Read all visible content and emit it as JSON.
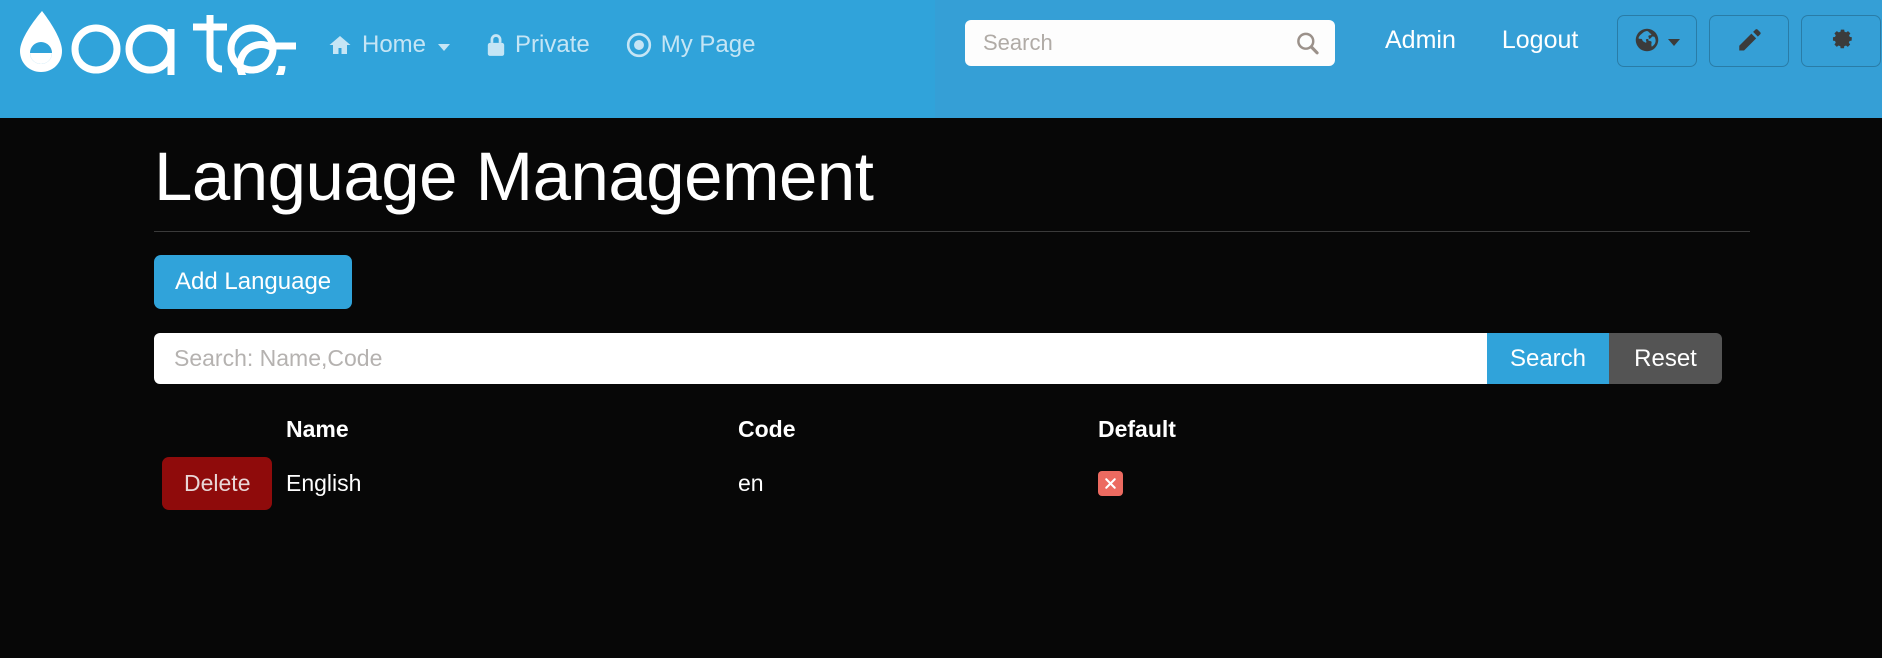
{
  "theme": {
    "header_blue": "#30a3da",
    "accent_blue": "#30a3da",
    "page_bg": "#070707",
    "delete_red": "#8f0b0b",
    "x_badge_red": "#ec6a60",
    "reset_gray": "#545454"
  },
  "header": {
    "logo_text": "oqtane",
    "logo_icon": "water-drop-icon",
    "nav": [
      {
        "label": "Home",
        "icon": "home-icon",
        "has_caret": true
      },
      {
        "label": "Private",
        "icon": "lock-icon",
        "has_caret": false
      },
      {
        "label": "My Page",
        "icon": "bullseye-icon",
        "has_caret": false
      }
    ],
    "search": {
      "placeholder": "Search",
      "value": "",
      "icon": "search-icon"
    },
    "links": [
      {
        "label": "Admin"
      },
      {
        "label": "Logout"
      }
    ],
    "icon_buttons": [
      {
        "icon": "globe-icon",
        "has_caret": true,
        "name": "language-selector-button"
      },
      {
        "icon": "pencil-icon",
        "has_caret": false,
        "name": "edit-mode-button"
      },
      {
        "icon": "gear-icon",
        "has_caret": false,
        "name": "settings-button"
      }
    ]
  },
  "main": {
    "page_title": "Language Management",
    "add_button_label": "Add Language",
    "search": {
      "placeholder": "Search: Name,Code",
      "value": "",
      "search_button_label": "Search",
      "reset_button_label": "Reset"
    },
    "table": {
      "columns": [
        "",
        "Name",
        "Code",
        "Default"
      ],
      "rows": [
        {
          "action_label": "Delete",
          "name": "English",
          "code": "en",
          "default": false,
          "default_icon": "x-mark-icon"
        }
      ]
    }
  }
}
